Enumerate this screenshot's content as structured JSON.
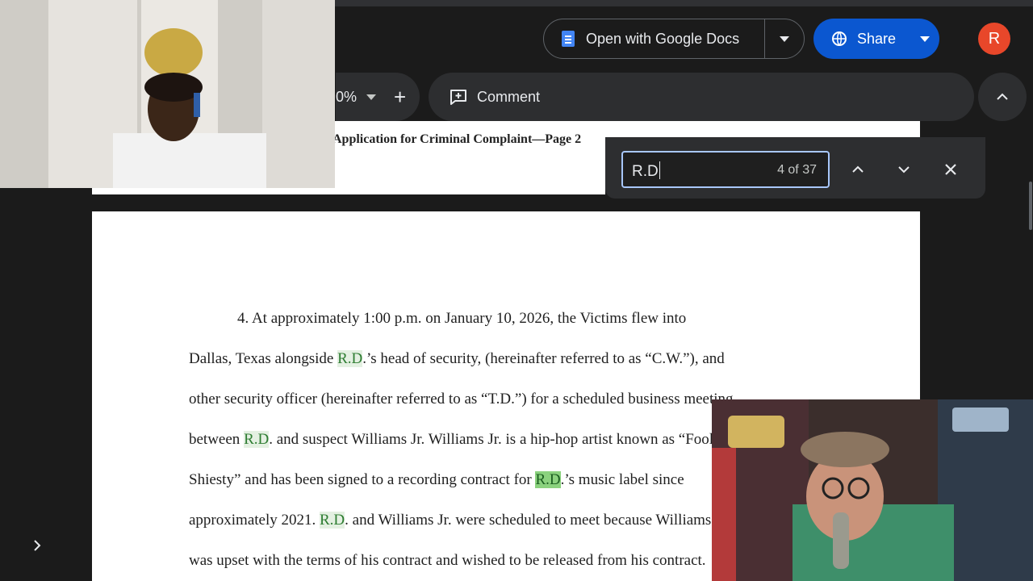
{
  "toolbar": {
    "open_with_label": "Open with Google Docs",
    "share_label": "Share",
    "avatar_initial": "R",
    "zoom_value": "0%",
    "plus_label": "+",
    "comment_label": "Comment"
  },
  "find": {
    "query": "R.D",
    "count": "4 of 37"
  },
  "document": {
    "page_header": "Application for Criminal Complaint—Page 2",
    "lines": [
      {
        "parts": [
          {
            "t": "4.        At approximately 1:00 p.m. on January 10, 2026, the Victims flew into"
          }
        ]
      },
      {
        "parts": [
          {
            "t": "Dallas, Texas alongside "
          },
          {
            "t": "R.D",
            "h": "hl"
          },
          {
            "t": ".’s head of security, (hereinafter referred to as “C.W.”), and"
          }
        ]
      },
      {
        "parts": [
          {
            "t": "other security officer (hereinafter referred to as “T.D.”) for a scheduled business meeting"
          }
        ]
      },
      {
        "parts": [
          {
            "t": "between "
          },
          {
            "t": "R.D",
            "h": "hl"
          },
          {
            "t": ". and suspect Williams Jr. Williams Jr. is a hip-hop artist known as “Foolio"
          }
        ]
      },
      {
        "parts": [
          {
            "t": "Shiesty” and has been signed to a recording contract for "
          },
          {
            "t": "R.D",
            "h": "hl-cur"
          },
          {
            "t": ".’s music label since"
          }
        ]
      },
      {
        "parts": [
          {
            "t": "approximately 2021. "
          },
          {
            "t": "R.D",
            "h": "hl"
          },
          {
            "t": ". and Williams Jr. were scheduled to meet because Williams Jr."
          }
        ]
      },
      {
        "parts": [
          {
            "t": "was upset with the terms of his contract and wished to be released from his contract."
          }
        ]
      }
    ]
  },
  "colors": {
    "share_bg": "#0b57d0",
    "avatar_bg": "#e8472a",
    "find_highlight": "#e4f0e2",
    "find_current": "#8bd27e"
  },
  "icons": [
    "docs-icon",
    "chevron-down-icon",
    "globe-icon",
    "comment-icon",
    "chevron-up-icon",
    "close-icon",
    "chevron-right-icon"
  ]
}
